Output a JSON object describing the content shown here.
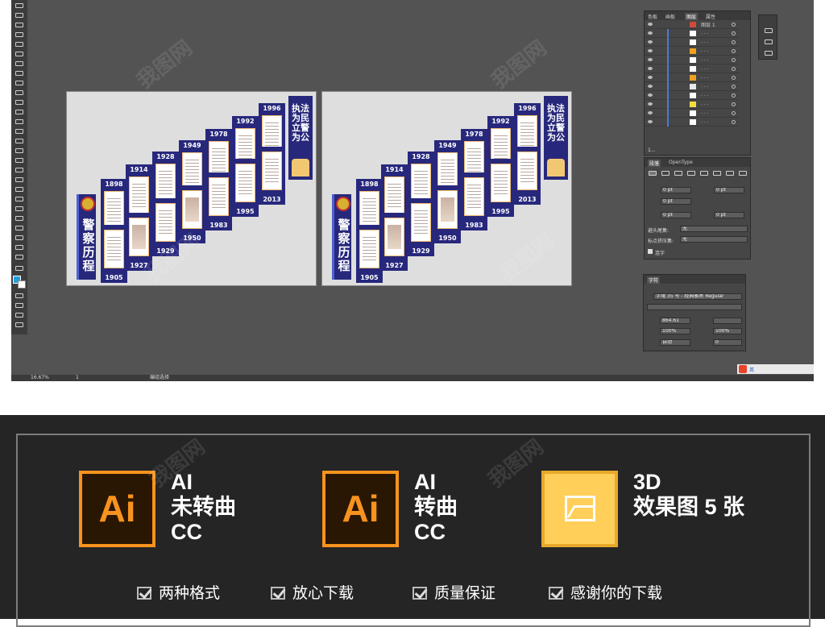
{
  "editor": {
    "zoom": "16.67%",
    "page": "1",
    "status": "编组选择"
  },
  "artboard": {
    "banner_title": "警察历程",
    "motto": "执法为民 立警为公",
    "years_top": [
      "1898",
      "1914",
      "1928",
      "1949",
      "1978",
      "1992",
      "1996"
    ],
    "years_bottom": [
      "1905",
      "1927",
      "1929",
      "1950",
      "1983",
      "1995",
      "2013"
    ]
  },
  "layers_panel": {
    "tabs": [
      "色板",
      "画板",
      "图层",
      "属性"
    ],
    "active_tab": "图层",
    "top_layer": "图层 1",
    "footer": "1..."
  },
  "paragraph_panel": {
    "tabs": [
      "段落",
      "OpenType"
    ],
    "indent_left": "0 pt",
    "indent_right": "0 pt",
    "indent_first": "0 pt",
    "space_before": "0 pt",
    "space_after": "0 pt",
    "kinsoku_label": "避头尾集:",
    "kinsoku_value": "无",
    "mojikumi_label": "标点挤压集:",
    "mojikumi_value": "无",
    "hyphenate": "连字"
  },
  "character_panel": {
    "tab": "字符",
    "font": "字魂 35 号 - 经典雅黑 Regular",
    "size": "864.61",
    "vscale": "100%",
    "hscale": "100%",
    "tracking": "自动",
    "kerning": "0"
  },
  "taskbar": {
    "ime_label": "英"
  },
  "features": [
    {
      "logo": "Ai",
      "lines": [
        "AI",
        "未转曲",
        "CC"
      ]
    },
    {
      "logo": "Ai",
      "lines": [
        "AI",
        "转曲",
        "CC"
      ]
    },
    {
      "logo": "image-icon",
      "lines": [
        "3D",
        "效果图 5 张"
      ]
    }
  ],
  "checks": [
    "两种格式",
    "放心下载",
    "质量保证",
    "感谢你的下载"
  ],
  "colors": {
    "navy": "#27287c",
    "gold": "#f2c772",
    "ai_orange": "#f7931e",
    "ai_bg": "#2a1703"
  }
}
